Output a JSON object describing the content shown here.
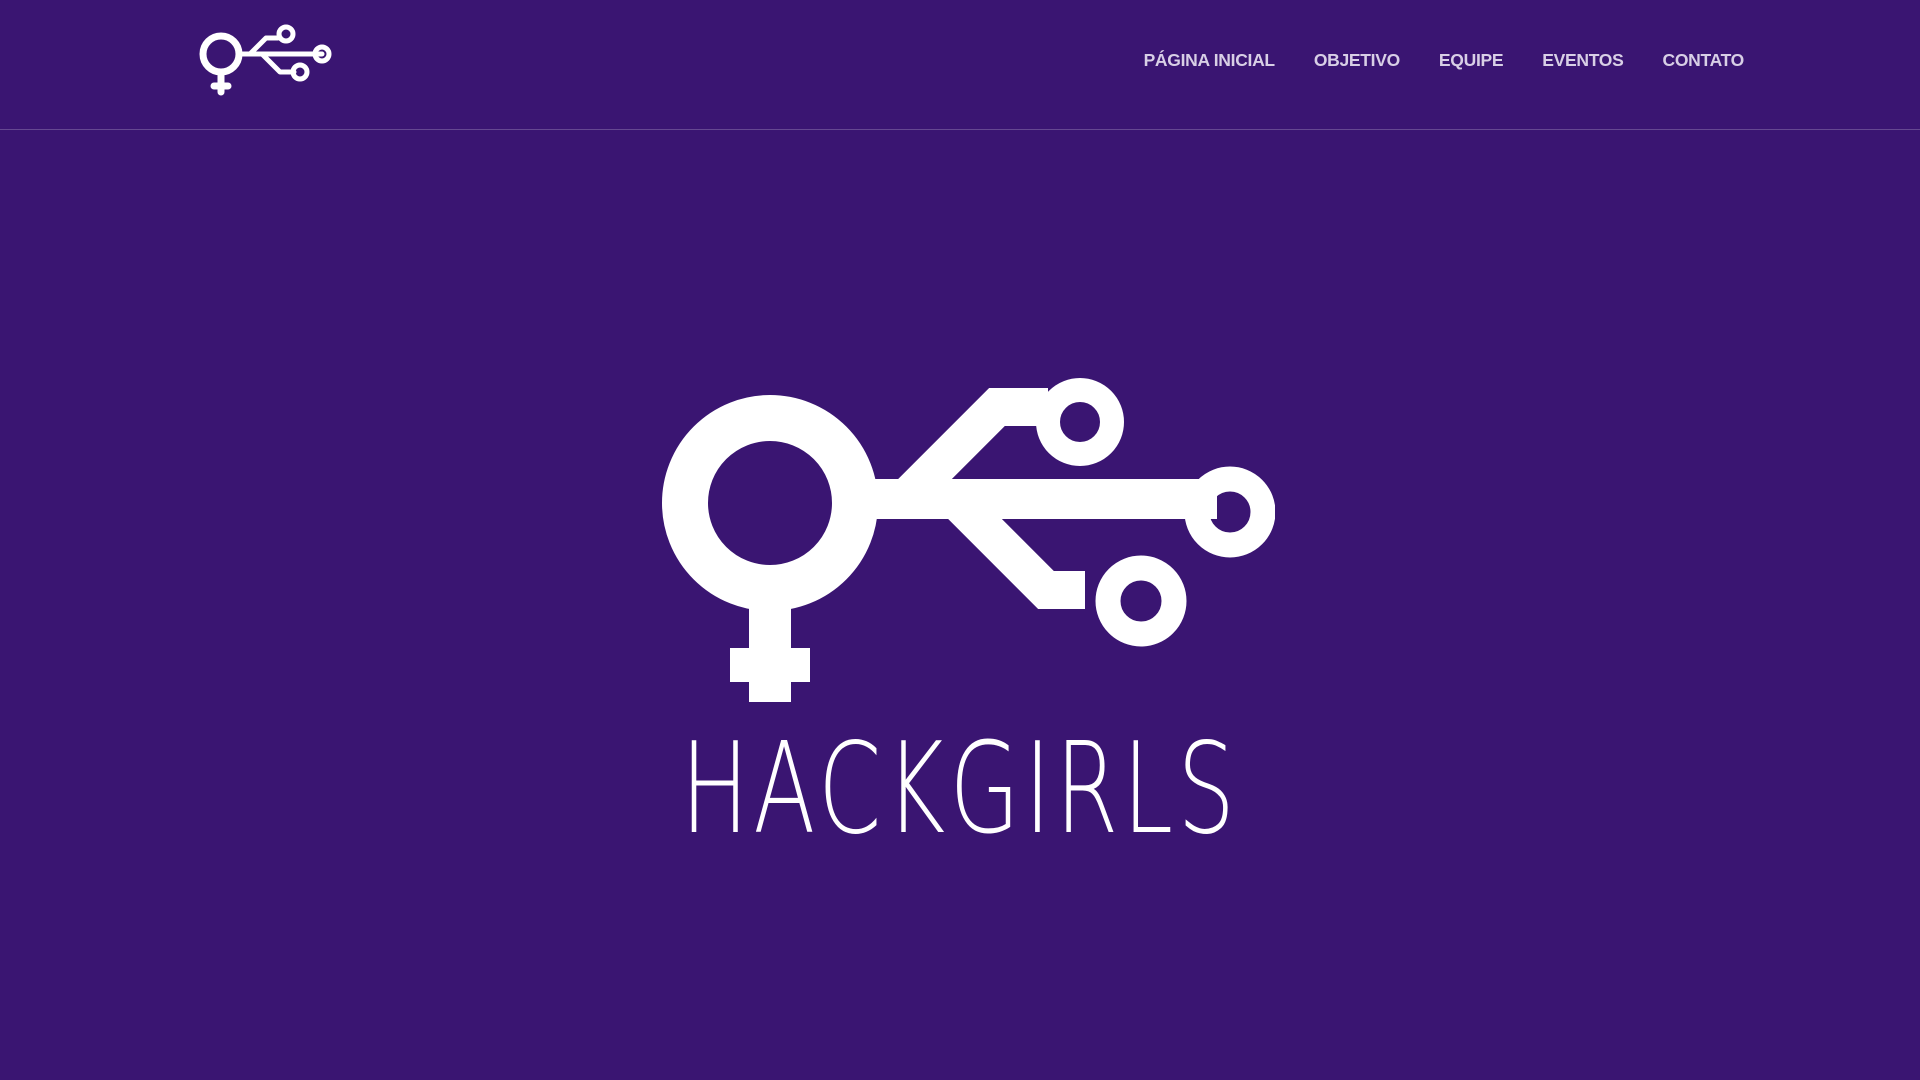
{
  "brand": {
    "name": "HACKGIRLS",
    "logo_icon": "venus-usb-icon",
    "background_color": "#3a1572",
    "logo_color": "#ffffff",
    "nav_color": "#d8cfe6"
  },
  "nav": {
    "items": [
      {
        "label": "PÁGINA INICIAL"
      },
      {
        "label": "OBJETIVO"
      },
      {
        "label": "EQUIPE"
      },
      {
        "label": "EVENTOS"
      },
      {
        "label": "CONTATO"
      }
    ]
  }
}
